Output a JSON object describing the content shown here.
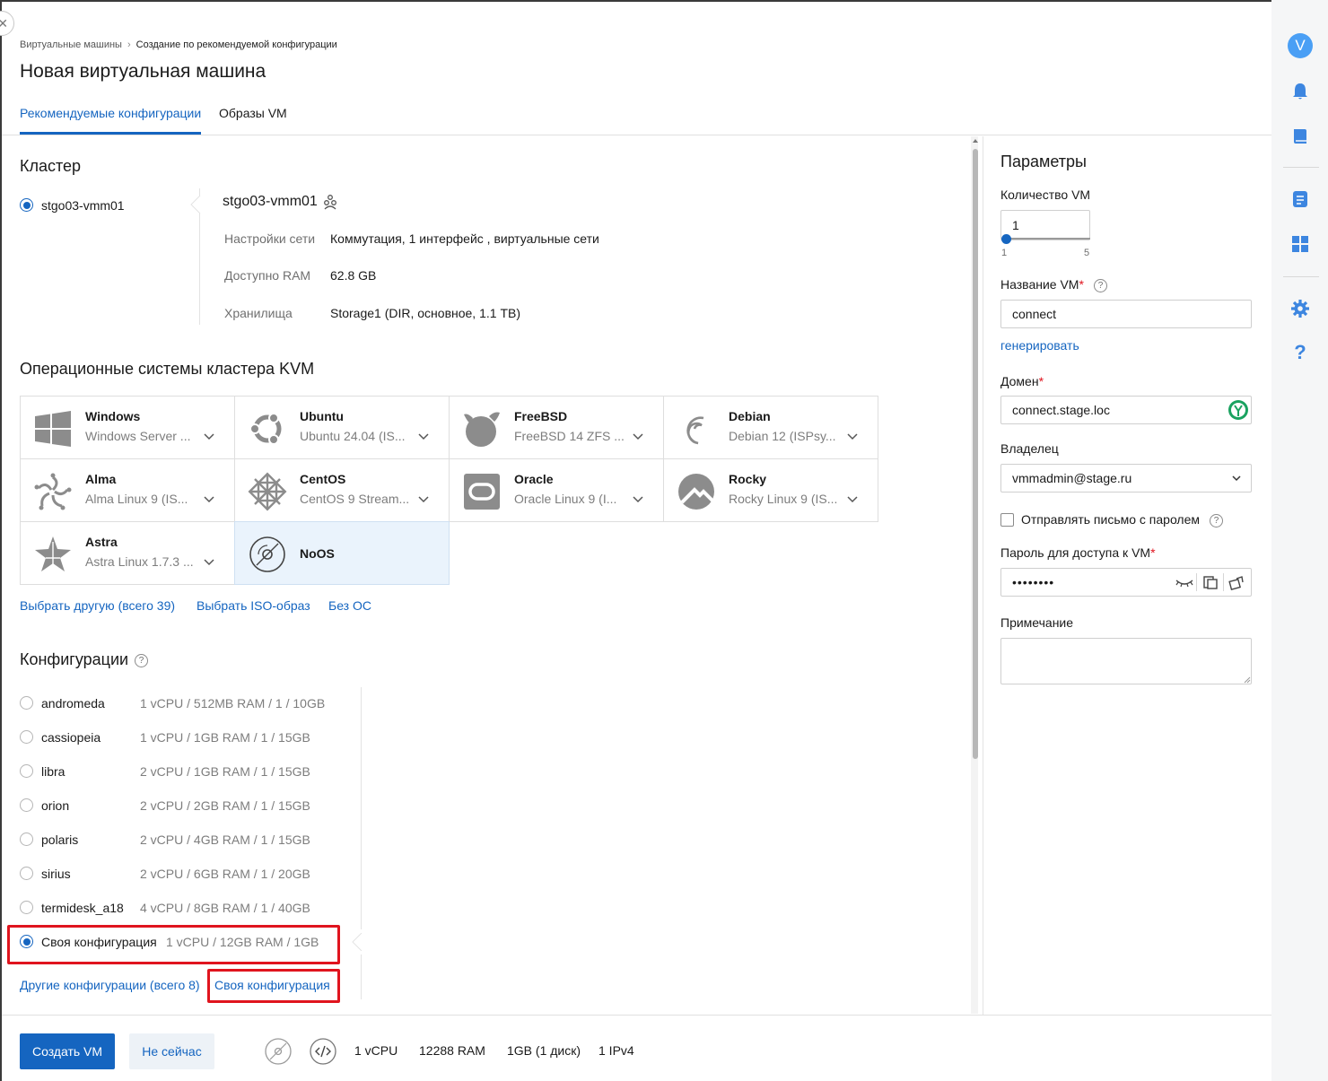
{
  "breadcrumb": {
    "parent": "Виртуальные машины",
    "separator": "›",
    "current": "Создание по рекомендуемой конфигурации"
  },
  "page_title": "Новая виртуальная машина",
  "tabs": [
    {
      "label": "Рекомендуемые конфигурации",
      "active": true
    },
    {
      "label": "Образы VM",
      "active": false
    }
  ],
  "cluster": {
    "heading": "Кластер",
    "option": "stgo03-vmm01",
    "detail_title": "stgo03-vmm01",
    "rows": [
      {
        "key": "Настройки сети",
        "value": "Коммутация, 1 интерфейс , виртуальные сети"
      },
      {
        "key": "Доступно RAM",
        "value": "62.8 GB"
      },
      {
        "key": "Хранилища",
        "value": "Storage1 (DIR, основное, 1.1 TB)"
      }
    ]
  },
  "os": {
    "heading": "Операционные системы кластера KVM",
    "items": [
      {
        "name": "Windows",
        "version": "Windows Server ...",
        "icon": "windows-icon"
      },
      {
        "name": "Ubuntu",
        "version": "Ubuntu 24.04 (IS...",
        "icon": "ubuntu-icon"
      },
      {
        "name": "FreeBSD",
        "version": "FreeBSD 14 ZFS ...",
        "icon": "freebsd-icon"
      },
      {
        "name": "Debian",
        "version": "Debian 12 (ISPsy...",
        "icon": "debian-icon"
      },
      {
        "name": "Alma",
        "version": "Alma Linux 9 (IS...",
        "icon": "alma-icon"
      },
      {
        "name": "CentOS",
        "version": "CentOS 9 Stream...",
        "icon": "centos-icon"
      },
      {
        "name": "Oracle",
        "version": "Oracle Linux 9 (I...",
        "icon": "oracle-icon"
      },
      {
        "name": "Rocky",
        "version": "Rocky Linux 9 (IS...",
        "icon": "rocky-icon"
      },
      {
        "name": "Astra",
        "version": "Astra Linux 1.7.3 ...",
        "icon": "astra-icon"
      },
      {
        "name": "NoOS",
        "version": "",
        "icon": "disc-icon"
      }
    ],
    "links": {
      "other": "Выбрать другую (всего 39)",
      "iso": "Выбрать ISO-образ",
      "none": "Без ОС"
    }
  },
  "configs": {
    "heading": "Конфигурации",
    "items": [
      {
        "name": "andromeda",
        "spec": "1 vCPU / 512MB RAM / 1 / 10GB"
      },
      {
        "name": "cassiopeia",
        "spec": "1 vCPU / 1GB RAM / 1 / 15GB"
      },
      {
        "name": "libra",
        "spec": "2 vCPU / 1GB RAM / 1 / 15GB"
      },
      {
        "name": "orion",
        "spec": "2 vCPU / 2GB RAM / 1 / 15GB"
      },
      {
        "name": "polaris",
        "spec": "2 vCPU / 4GB RAM / 1 / 15GB"
      },
      {
        "name": "sirius",
        "spec": "2 vCPU / 6GB RAM / 1 / 20GB"
      },
      {
        "name": "termidesk_a18",
        "spec": "4 vCPU / 8GB RAM / 1 / 40GB"
      }
    ],
    "custom": {
      "name": "Своя конфигурация",
      "spec": "1 vCPU / 12GB RAM / 1GB"
    },
    "links": {
      "other": "Другие конфигурации (всего 8)",
      "custom": "Своя конфигурация"
    }
  },
  "params": {
    "heading": "Параметры",
    "vm_count": {
      "label": "Количество VM",
      "value": "1",
      "min": "1",
      "max": "5"
    },
    "vm_name": {
      "label": "Название VM",
      "required": "*",
      "value": "connect",
      "generate": "генерировать"
    },
    "domain": {
      "label": "Домен",
      "required": "*",
      "value": "connect.stage.loc"
    },
    "owner": {
      "label": "Владелец",
      "value": "vmmadmin@stage.ru"
    },
    "send_mail": {
      "label": "Отправлять письмо с паролем",
      "checked": false
    },
    "password": {
      "label": "Пароль для доступа к VM",
      "required": "*",
      "value": "••••••••"
    },
    "note": {
      "label": "Примечание",
      "value": ""
    }
  },
  "footer": {
    "create": "Создать VM",
    "cancel": "Не сейчас",
    "summary": {
      "cpu": "1 vCPU",
      "ram": "12288 RAM",
      "disk": "1GB (1 диск)",
      "ip": "1 IPv4"
    }
  },
  "user": {
    "avatar_letter": "V"
  },
  "colors": {
    "accent": "#1565c0",
    "highlight": "#e0141e",
    "selected_bg": "#eaf3fc",
    "avatar": "#4a9ff5"
  }
}
